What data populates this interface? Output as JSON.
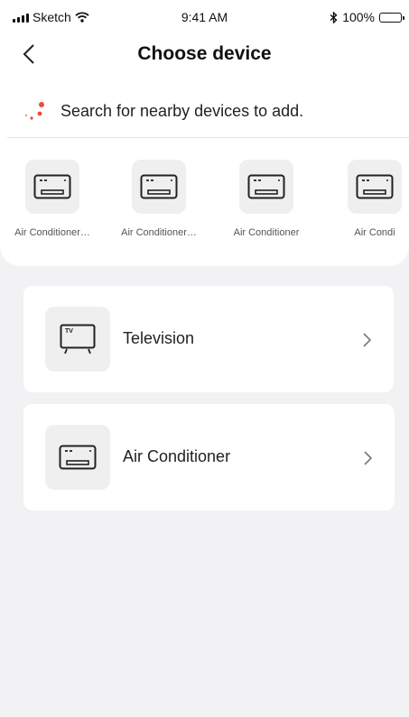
{
  "status_bar": {
    "carrier": "Sketch",
    "time": "9:41 AM",
    "battery": "100%"
  },
  "header": {
    "title": "Choose device",
    "back_icon": "back-chevron-icon"
  },
  "search": {
    "text": "Search for nearby devices to add.",
    "icon": "scanning-dots-icon",
    "accent_color": "#f04a3a"
  },
  "scanned_devices": [
    {
      "label": "Air Conditioner…",
      "icon": "air-conditioner-icon"
    },
    {
      "label": "Air Conditioner…",
      "icon": "air-conditioner-icon"
    },
    {
      "label": "Air Conditioner",
      "icon": "air-conditioner-icon"
    },
    {
      "label": "Air Condi",
      "icon": "air-conditioner-icon"
    }
  ],
  "device_types": [
    {
      "name": "Television",
      "icon": "television-icon"
    },
    {
      "name": "Air Conditioner",
      "icon": "air-conditioner-icon"
    }
  ]
}
